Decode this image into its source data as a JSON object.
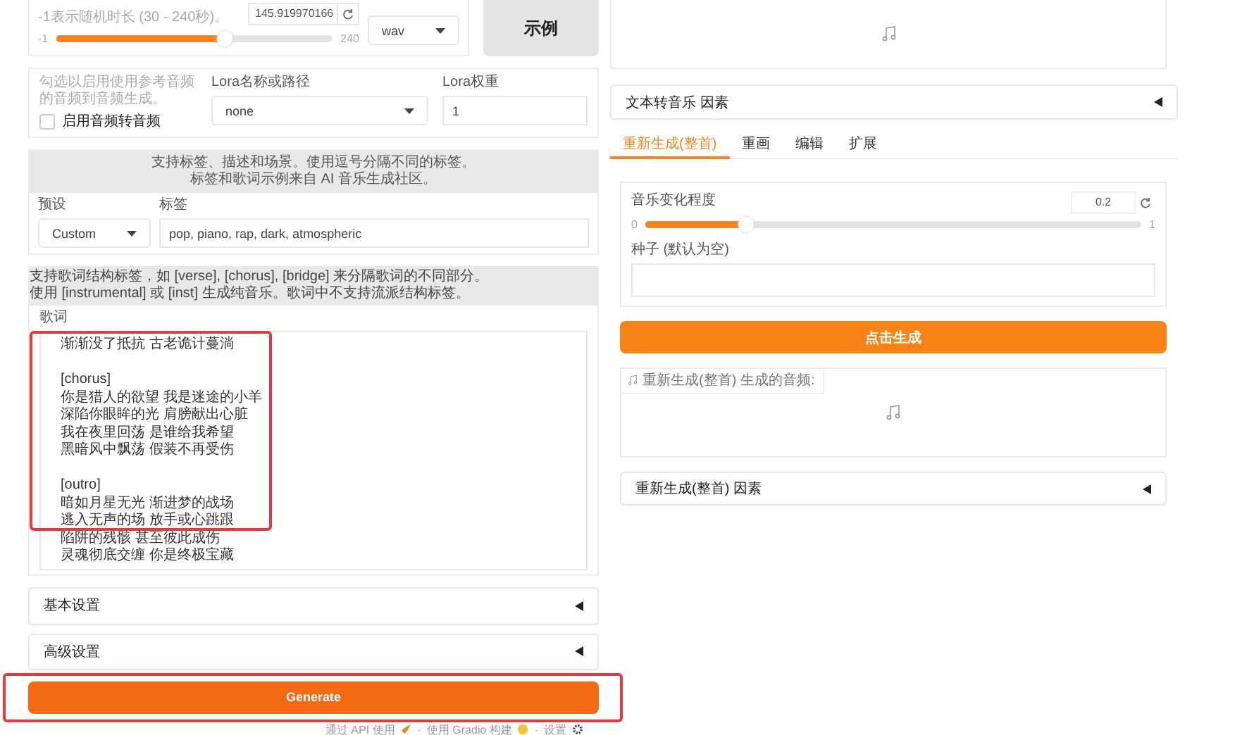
{
  "duration": {
    "hint": "-1表示随机时长 (30 - 240秒)。",
    "value": "145.919970166",
    "min": "-1",
    "max": "240",
    "level": 0.61
  },
  "format": {
    "value": "wav"
  },
  "example_button": "示例",
  "audio2audio": {
    "hint": "勾选以启用使用参考音频的音频到音频生成。",
    "checkbox": {
      "label": "启用音频转音频",
      "checked": false
    }
  },
  "lora": {
    "label": "Lora名称或路径",
    "value": "none"
  },
  "lora_weight": {
    "label": "Lora权重",
    "value": "1"
  },
  "tags_info": [
    "支持标签、描述和场景。使用逗号分隔不同的标签。",
    "标签和歌词示例来自 AI 音乐生成社区。"
  ],
  "preset": {
    "label": "预设",
    "value": "Custom"
  },
  "tags": {
    "label": "标签",
    "value": "pop, piano, rap, dark, atmospheric"
  },
  "lyrics_info": [
    "支持歌词结构标签，如 [verse], [chorus], [bridge] 来分隔歌词的不同部分。",
    "使用 [instrumental] 或 [inst] 生成纯音乐。歌词中不支持流派结构标签。"
  ],
  "lyrics": {
    "label": "歌词",
    "highlighted": true,
    "stanzas": [
      {
        "lines": [
          "渐渐没了抵抗 古老诡计蔓淌"
        ]
      },
      {
        "lines": [
          "[chorus]",
          "你是猎人的欲望 我是迷途的小羊",
          "深陷你眼眸的光 肩膀献出心脏",
          "我在夜里回荡 是谁给我希望",
          "黑暗风中飘荡 假装不再受伤"
        ]
      },
      {
        "lines": [
          "[outro]",
          "暗如月星无光 渐进梦的战场",
          "逃入无声的场 放手或心跳跟",
          "陷阱的残骸 甚至彼此成伤",
          "灵魂彻底交缠 你是终极宝藏"
        ]
      }
    ]
  },
  "accordions_left": [
    {
      "label": "基本设置",
      "expanded": false
    },
    {
      "label": "高级设置",
      "expanded": false
    }
  ],
  "generate_button": {
    "label": "Generate",
    "highlighted": true
  },
  "footer": {
    "separator": "·",
    "links": [
      "通过 API 使用",
      "使用 Gradio 构建",
      "设置"
    ]
  },
  "text2music_accordion": {
    "label": "文本转音乐 因素",
    "expanded": false
  },
  "tabs": [
    {
      "label": "重新生成(整首)",
      "selected": true
    },
    {
      "label": "重画",
      "selected": false
    },
    {
      "label": "编辑",
      "selected": false
    },
    {
      "label": "扩展",
      "selected": false
    }
  ],
  "variance": {
    "label": "音乐变化程度",
    "value": "0.2",
    "min": "0",
    "max": "1",
    "level": 0.2
  },
  "seed": {
    "label": "种子 (默认为空)"
  },
  "retake_button": "点击生成",
  "output_audio": {
    "label": "重新生成(整首) 生成的音频:"
  },
  "retake_accordion": {
    "label": "重新生成(整首) 因素",
    "expanded": false
  }
}
